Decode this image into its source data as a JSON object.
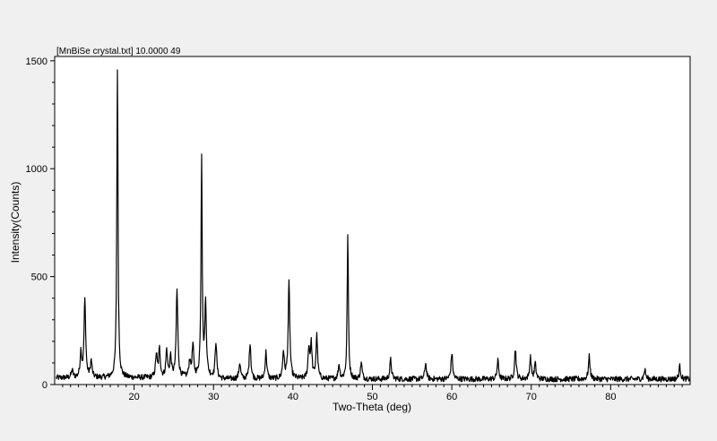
{
  "chart_data": {
    "type": "line",
    "header": "[MnBiSe  crystal.txt] 10.0000      49",
    "xlabel": "Two-Theta (deg)",
    "ylabel": "Intensity(Counts)",
    "xlim": [
      10,
      90
    ],
    "ylim": [
      0,
      1520
    ],
    "x_ticks": [
      20,
      30,
      40,
      50,
      60,
      70,
      80
    ],
    "y_ticks": [
      0,
      500,
      1000,
      1500
    ],
    "grid": false,
    "legend": "none",
    "line_color": "#000000",
    "baseline": 25,
    "peaks": [
      {
        "x": 12.2,
        "y": 60
      },
      {
        "x": 13.3,
        "y": 140
      },
      {
        "x": 13.8,
        "y": 385
      },
      {
        "x": 14.6,
        "y": 100
      },
      {
        "x": 17.9,
        "y": 1460
      },
      {
        "x": 22.8,
        "y": 130
      },
      {
        "x": 23.2,
        "y": 155
      },
      {
        "x": 24.1,
        "y": 150
      },
      {
        "x": 24.6,
        "y": 120
      },
      {
        "x": 25.4,
        "y": 430
      },
      {
        "x": 27.0,
        "y": 100
      },
      {
        "x": 27.4,
        "y": 170
      },
      {
        "x": 28.5,
        "y": 1050
      },
      {
        "x": 29.0,
        "y": 360
      },
      {
        "x": 30.3,
        "y": 195
      },
      {
        "x": 33.3,
        "y": 100
      },
      {
        "x": 34.6,
        "y": 195
      },
      {
        "x": 36.6,
        "y": 150
      },
      {
        "x": 38.8,
        "y": 150
      },
      {
        "x": 39.5,
        "y": 470
      },
      {
        "x": 42.0,
        "y": 165
      },
      {
        "x": 42.3,
        "y": 180
      },
      {
        "x": 43.0,
        "y": 225
      },
      {
        "x": 45.8,
        "y": 90
      },
      {
        "x": 46.9,
        "y": 690
      },
      {
        "x": 48.6,
        "y": 100
      },
      {
        "x": 52.3,
        "y": 115
      },
      {
        "x": 56.7,
        "y": 100
      },
      {
        "x": 60.0,
        "y": 145
      },
      {
        "x": 65.8,
        "y": 110
      },
      {
        "x": 68.0,
        "y": 165
      },
      {
        "x": 69.9,
        "y": 125
      },
      {
        "x": 70.5,
        "y": 95
      },
      {
        "x": 77.3,
        "y": 130
      },
      {
        "x": 84.3,
        "y": 70
      },
      {
        "x": 88.7,
        "y": 85
      }
    ]
  }
}
